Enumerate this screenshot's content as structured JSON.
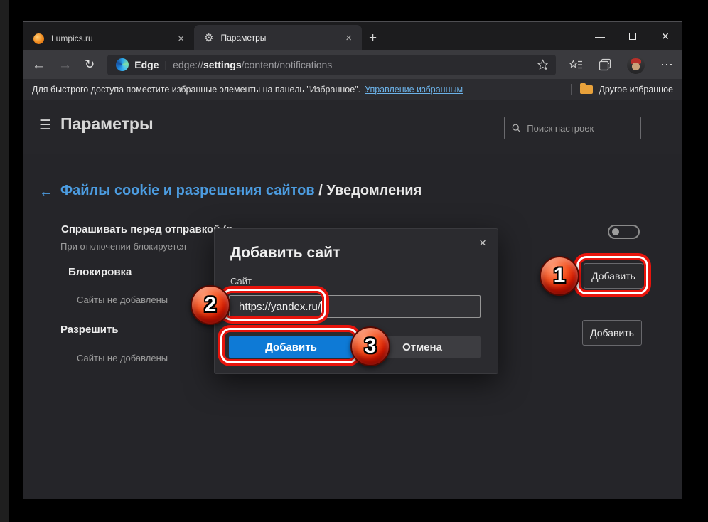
{
  "tabs": [
    {
      "title": "Lumpics.ru"
    },
    {
      "title": "Параметры"
    }
  ],
  "icons": {
    "minimize": "—",
    "close": "×",
    "tab_close": "×",
    "new_tab": "+",
    "back": "←",
    "forward": "→",
    "refresh": "↻",
    "more": "⋯",
    "hamburger": "☰",
    "gear": "⚙",
    "breadcrumb_back": "←",
    "pipe": "|",
    "dialog_close": "×"
  },
  "toolbar": {
    "brand": "Edge",
    "url": {
      "scheme": "edge://",
      "host": "settings",
      "path": "/content/notifications"
    }
  },
  "favorites_bar": {
    "notice": "Для быстрого доступа поместите избранные элементы на панель \"Избранное\".",
    "manage_link": "Управление избранным",
    "other_favorites": "Другое избранное"
  },
  "settings_header": {
    "title": "Параметры",
    "search_placeholder": "Поиск настроек"
  },
  "page": {
    "breadcrumb": {
      "link": "Файлы cookie и разрешения сайтов",
      "separator": " / ",
      "current": "Уведомления"
    },
    "ask": {
      "title": "Спрашивать перед отправкой (р",
      "subtitle": "При отключении блокируется",
      "toggle_state": "off"
    },
    "block": {
      "title": "Блокировка",
      "empty": "Сайты не добавлены",
      "add_label": "Добавить"
    },
    "allow": {
      "title": "Разрешить",
      "empty": "Сайты не добавлены",
      "add_label": "Добавить"
    }
  },
  "dialog": {
    "title": "Добавить сайт",
    "field_label": "Сайт",
    "field_value": "https://yandex.ru/",
    "add_label": "Добавить",
    "cancel_label": "Отмена"
  },
  "callouts": {
    "step1": "1",
    "step2": "2",
    "step3": "3"
  },
  "colors": {
    "accent_blue": "#0e7ad6",
    "heading_blue": "#4c9ce0",
    "link_blue": "#6cb2e8",
    "annotation_red": "#e8140c",
    "folder_yellow": "#e9a23b"
  }
}
